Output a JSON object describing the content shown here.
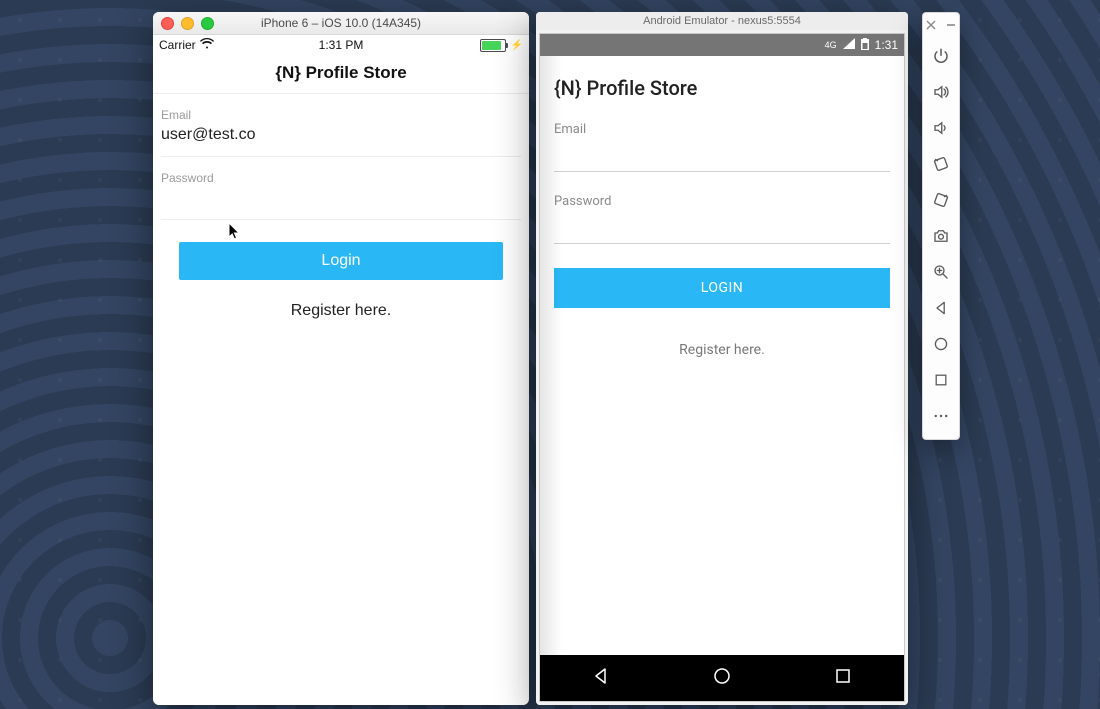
{
  "ios": {
    "window_title": "iPhone 6 – iOS 10.0 (14A345)",
    "carrier": "Carrier",
    "time": "1:31 PM",
    "app_title": "{N} Profile Store",
    "email_label": "Email",
    "email_value": "user@test.co",
    "password_label": "Password",
    "password_value": "",
    "login_button": "Login",
    "register_link": "Register here."
  },
  "android": {
    "window_title": "Android Emulator - nexus5:5554",
    "status_network": "4G",
    "time": "1:31",
    "app_title": "{N} Profile Store",
    "email_label": "Email",
    "email_value": "",
    "password_label": "Password",
    "password_value": "",
    "login_button": "LOGIN",
    "register_link": "Register here."
  },
  "toolbar": {
    "icons": [
      "close",
      "minimize",
      "power",
      "volume-up",
      "volume-down",
      "rotate-left",
      "rotate-right",
      "camera",
      "zoom",
      "back",
      "home",
      "recent",
      "more"
    ]
  },
  "colors": {
    "accent": "#29b8f5",
    "android_status": "#757575"
  }
}
